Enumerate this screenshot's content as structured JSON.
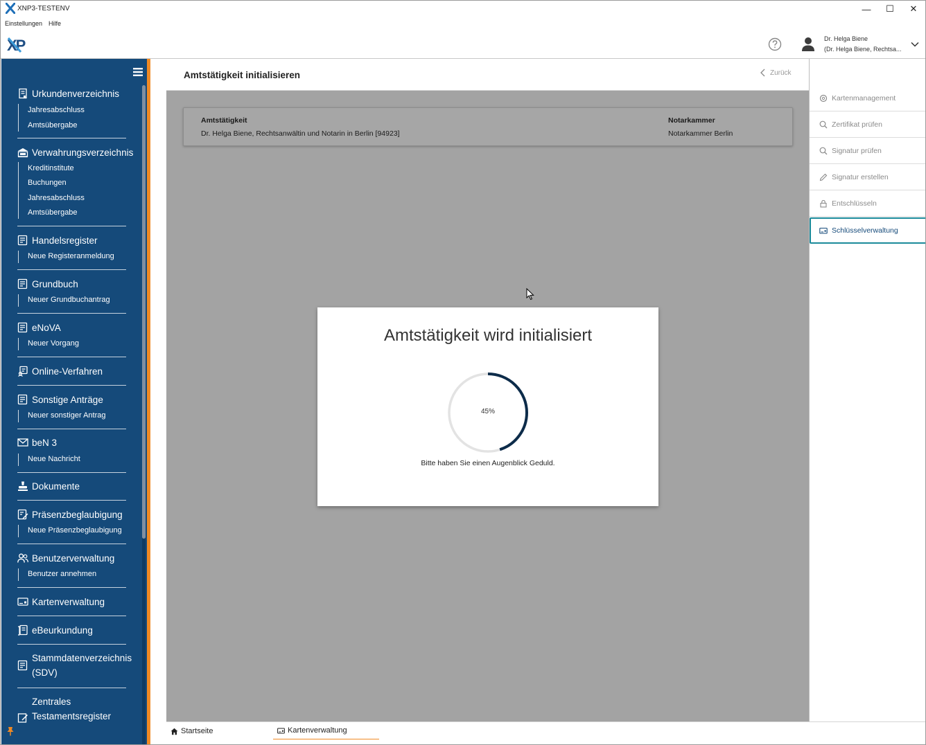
{
  "window": {
    "title": "XNP3-TESTENV",
    "minimize": "—",
    "maximize": "☐",
    "close": "✕"
  },
  "menu": {
    "items": [
      "Einstellungen",
      "Hilfe"
    ]
  },
  "header": {
    "logo_text": "XNP",
    "user_name": "Dr. Helga Biene",
    "user_sub": "(Dr. Helga Biene, Rechtsa..."
  },
  "sidebar": {
    "sections": [
      {
        "label": "Urkundenverzeichnis",
        "icon": "register-icon",
        "subs": [
          "Jahresabschluss",
          "Amtsübergabe"
        ]
      },
      {
        "label": "Verwahrungsverzeichnis",
        "icon": "bank-icon",
        "subs": [
          "Kreditinstitute",
          "Buchungen",
          "Jahresabschluss",
          "Amtsübergabe"
        ]
      },
      {
        "label": "Handelsregister",
        "icon": "form-icon",
        "subs": [
          "Neue Registeranmeldung"
        ]
      },
      {
        "label": "Grundbuch",
        "icon": "form-icon",
        "subs": [
          "Neuer Grundbuchantrag"
        ]
      },
      {
        "label": "eNoVA",
        "icon": "form-icon",
        "subs": [
          "Neuer Vorgang"
        ]
      },
      {
        "label": "Online-Verfahren",
        "icon": "online-icon",
        "subs": []
      },
      {
        "label": "Sonstige Anträge",
        "icon": "form-icon",
        "subs": [
          "Neuer sonstiger Antrag"
        ]
      },
      {
        "label": "beN 3",
        "icon": "mail-icon",
        "subs": [
          "Neue Nachricht"
        ]
      },
      {
        "label": "Dokumente",
        "icon": "stamp-icon",
        "subs": []
      },
      {
        "label": "Präsenzbeglaubigung",
        "icon": "edit-doc-icon",
        "subs": [
          "Neue Präsenzbeglaubigung"
        ]
      },
      {
        "label": "Benutzerverwaltung",
        "icon": "users-icon",
        "subs": [
          "Benutzer annehmen"
        ]
      },
      {
        "label": "Kartenverwaltung",
        "icon": "card-icon",
        "subs": []
      },
      {
        "label": "eBeurkundung",
        "icon": "ebeurkundung-icon",
        "subs": []
      },
      {
        "label_line1": "Stammdatenverzeichnis",
        "label_line2": "(SDV)",
        "icon": "form-icon",
        "subs": []
      },
      {
        "label_line1": "Zentrales",
        "label_line2": "Testamentsregister",
        "icon": "testament-icon",
        "subs": []
      }
    ]
  },
  "main": {
    "title": "Amtstätigkeit initialisieren",
    "back_label": "Zurück",
    "info": {
      "label1": "Amtstätigkeit",
      "value1": "Dr. Helga Biene, Rechtsanwältin und Notarin in Berlin [94923]",
      "label2": "Notarkammer",
      "value2": "Notarkammer Berlin"
    },
    "modal": {
      "title": "Amtstätigkeit wird initialisiert",
      "progress": 45,
      "progress_label": "45%",
      "message": "Bitte haben Sie einen Augenblick Geduld."
    }
  },
  "right_panel": {
    "items": [
      {
        "label": "Kartenmanagement",
        "icon": "gear-icon",
        "active": false
      },
      {
        "label": "Zertifikat prüfen",
        "icon": "search-icon",
        "active": false
      },
      {
        "label": "Signatur prüfen",
        "icon": "search-icon",
        "active": false
      },
      {
        "label": "Signatur erstellen",
        "icon": "pen-icon",
        "active": false
      },
      {
        "label": "Entschlüsseln",
        "icon": "lock-icon",
        "active": false
      },
      {
        "label": "Schlüsselverwaltung",
        "icon": "card-icon",
        "active": true
      }
    ]
  },
  "tabs": [
    {
      "label": "Startseite",
      "icon": "home-icon",
      "active": false
    },
    {
      "label": "Kartenverwaltung",
      "icon": "card-icon",
      "active": true
    }
  ],
  "colors": {
    "sidebar": "#154a7a",
    "accent": "#f08a24",
    "overlay": "#a3a3a3",
    "progress": "#0d2c4a",
    "active_border": "#1a8a9a"
  }
}
